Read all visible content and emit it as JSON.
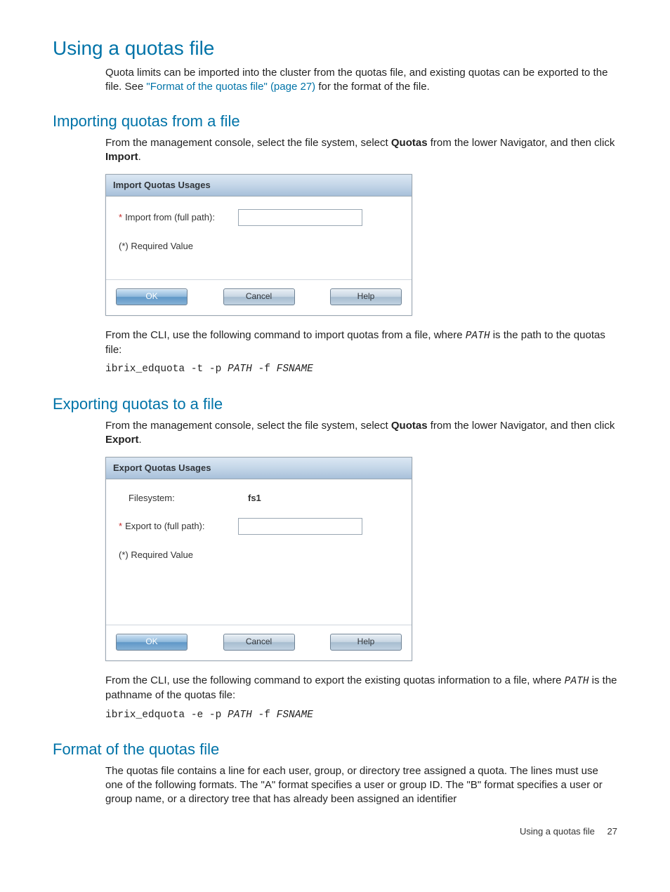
{
  "headings": {
    "h1": "Using a quotas file",
    "h2_import": "Importing quotas from a file",
    "h2_export": "Exporting quotas to a file",
    "h2_format": "Format of the quotas file"
  },
  "paragraphs": {
    "intro_pre": "Quota limits can be imported into the cluster from the quotas file, and existing quotas can be exported to the file. See ",
    "intro_link": "\"Format of the quotas file\" (page 27)",
    "intro_post": " for the format of the file.",
    "import_p_pre": "From the management console, select the file system, select ",
    "import_p_quotas": "Quotas",
    "import_p_mid": " from the lower Navigator, and then click ",
    "import_p_import": "Import",
    "period": ".",
    "import_cli_pre": "From the CLI, use the following command to import quotas from a file, where ",
    "import_cli_path": "PATH",
    "import_cli_post": " is the path to the quotas file:",
    "export_p_pre": "From the management console, select the file system, select ",
    "export_p_quotas": "Quotas",
    "export_p_mid": " from the lower Navigator, and then click ",
    "export_p_export": "Export",
    "export_cli_pre": "From the CLI, use the following command to export the existing quotas information to a file, where ",
    "export_cli_path": "PATH",
    "export_cli_post": " is the pathname of the quotas file:",
    "format_p": "The quotas file contains a line for each user, group, or directory tree assigned a quota. The lines must use one of the following formats. The \"A\" format specifies a user or group ID. The \"B\" format specifies a user or group name, or a directory tree that has already been assigned an identifier"
  },
  "commands": {
    "import_cmd_a": "ibrix_edquota -t -p ",
    "import_cmd_b": "PATH",
    "import_cmd_c": " -f ",
    "import_cmd_d": "FSNAME",
    "export_cmd_a": "ibrix_edquota -e -p ",
    "export_cmd_b": "PATH",
    "export_cmd_c": " -f ",
    "export_cmd_d": "FSNAME"
  },
  "dialogs": {
    "import": {
      "title": "Import Quotas Usages",
      "label_from": "Import from (full path):",
      "required": "(*) Required Value",
      "ok": "OK",
      "cancel": "Cancel",
      "help": "Help"
    },
    "export": {
      "title": "Export Quotas Usages",
      "label_fs": "Filesystem:",
      "value_fs": "fs1",
      "label_to": "Export to (full path):",
      "required": "(*) Required Value",
      "ok": "OK",
      "cancel": "Cancel",
      "help": "Help"
    }
  },
  "footer": {
    "text": "Using a quotas file",
    "page": "27"
  }
}
